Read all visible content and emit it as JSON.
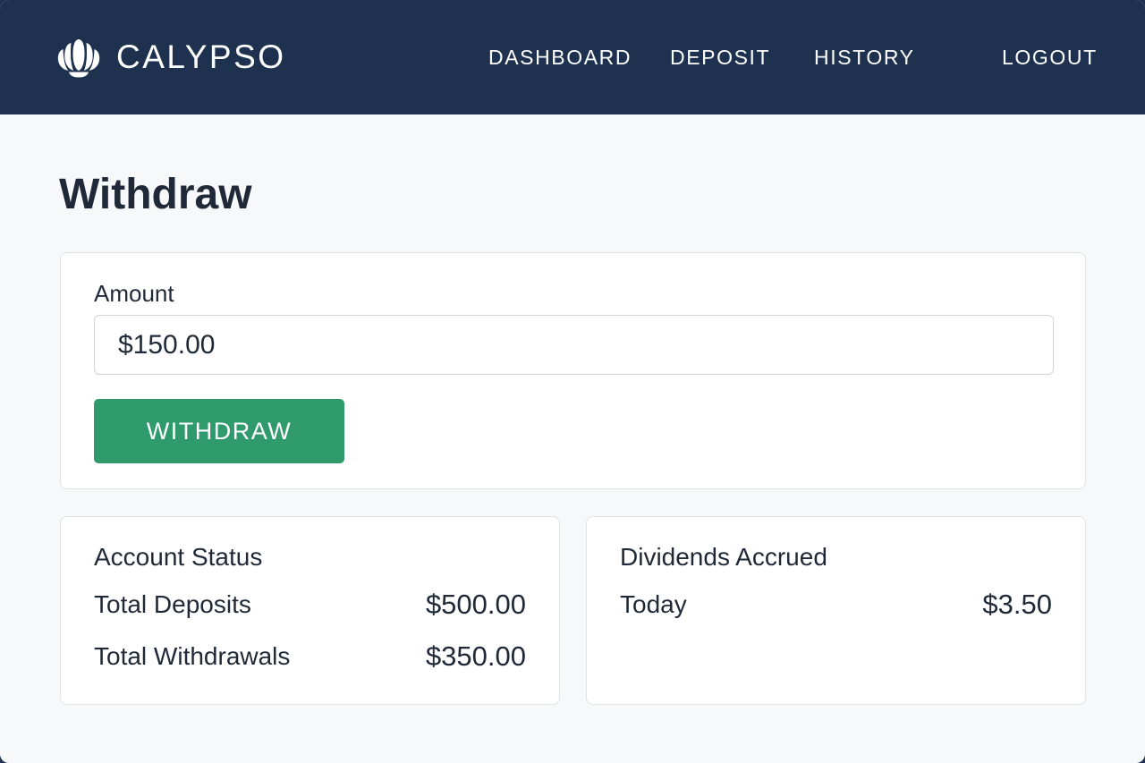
{
  "nav": {
    "brand": "CALYPSO",
    "brand_icon": "seashell-icon",
    "items": [
      {
        "label": "DASHBOARD"
      },
      {
        "label": "DEPOSIT"
      },
      {
        "label": "HISTORY"
      },
      {
        "label": "LOGOUT"
      }
    ]
  },
  "page": {
    "title": "Withdraw"
  },
  "form": {
    "amount_label": "Amount",
    "amount_value": "$150.00",
    "submit_label": "WITHDRAW"
  },
  "account_status": {
    "heading": "Account Status",
    "rows": [
      {
        "label": "Total Deposits",
        "value": "$500.00"
      },
      {
        "label": "Total Withdrawals",
        "value": "$350.00"
      }
    ]
  },
  "dividends": {
    "heading": "Dividends Accrued",
    "rows": [
      {
        "label": "Today",
        "value": "$3.50"
      }
    ]
  },
  "colors": {
    "navbar": "#1e3250",
    "accent_green": "#2f9a6c",
    "page_background": "#f7f8f9",
    "text_dark": "#1f2937"
  }
}
